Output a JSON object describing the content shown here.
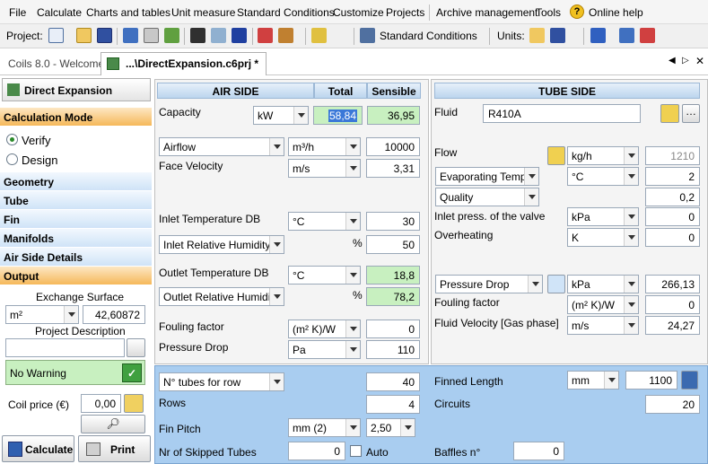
{
  "menu": [
    "File",
    "Calculate",
    "Charts and tables",
    "Unit measure",
    "Standard Conditions",
    "Customize",
    "Projects",
    "Archive management",
    "Tools",
    "Online help"
  ],
  "toolbar": {
    "project_label": "Project:",
    "conditions_label": "Standard Conditions",
    "units_label": "Units:"
  },
  "tabs": {
    "welcome": "Coils 8.0 - Welcome!",
    "active": "...\\DirectExpansion.c6prj *"
  },
  "left": {
    "title": "Direct Expansion",
    "calc_mode": "Calculation Mode",
    "verify": "Verify",
    "design": "Design",
    "sections": [
      "Geometry",
      "Tube",
      "Fin",
      "Manifolds",
      "Air Side Details",
      "Output"
    ],
    "exchange_surface_label": "Exchange Surface",
    "surface_unit": "m²",
    "surface_value": "42,60872",
    "project_desc_label": "Project Description",
    "project_desc_value": "",
    "warning": "No Warning",
    "coil_price_label": "Coil price (€)",
    "coil_price_value": "0,00",
    "calculate": "Calculate",
    "print": "Print"
  },
  "air": {
    "header": "AIR SIDE",
    "total": "Total",
    "sensible": "Sensible",
    "capacity_label": "Capacity",
    "capacity_unit": "kW",
    "capacity_total": "58,84",
    "capacity_sensible": "36,95",
    "airflow_select": "Airflow",
    "airflow_unit": "m³/h",
    "airflow_value": "10000",
    "face_velocity_label": "Face Velocity",
    "face_velocity_unit": "m/s",
    "face_velocity_value": "3,31",
    "inlet_temp_label": "Inlet Temperature DB",
    "inlet_temp_unit": "°C",
    "inlet_temp_value": "30",
    "inlet_rh_select": "Inlet Relative Humidity",
    "inlet_rh_unit": "%",
    "inlet_rh_value": "50",
    "outlet_temp_label": "Outlet Temperature DB",
    "outlet_temp_unit": "°C",
    "outlet_temp_value": "18,8",
    "outlet_rh_select": "Outlet Relative Humidity",
    "outlet_rh_unit": "%",
    "outlet_rh_value": "78,2",
    "fouling_label": "Fouling factor",
    "fouling_unit": "(m² K)/W",
    "fouling_value": "0",
    "pressure_label": "Pressure Drop",
    "pressure_unit": "Pa",
    "pressure_value": "110"
  },
  "tube": {
    "header": "TUBE SIDE",
    "fluid_label": "Fluid",
    "fluid_value": "R410A",
    "flow_label": "Flow",
    "flow_unit": "kg/h",
    "flow_value": "1210",
    "evap_select": "Evaporating Temp.",
    "evap_unit": "°C",
    "evap_value": "2",
    "quality_select": "Quality",
    "quality_value": "0,2",
    "inlet_press_label": "Inlet press. of the valve",
    "inlet_press_unit": "kPa",
    "inlet_press_value": "0",
    "overheating_label": "Overheating",
    "overheating_unit": "K",
    "overheating_value": "0",
    "pdrop_select": "Pressure Drop",
    "pdrop_unit": "kPa",
    "pdrop_value": "266,13",
    "fouling_label": "Fouling factor",
    "fouling_unit": "(m² K)/W",
    "fouling_value": "0",
    "velocity_label": "Fluid Velocity [Gas phase]",
    "velocity_unit": "m/s",
    "velocity_value": "24,27"
  },
  "geom": {
    "tubes_select": "N° tubes for row",
    "tubes_value": "40",
    "rows_label": "Rows",
    "rows_value": "4",
    "fin_pitch_label": "Fin Pitch",
    "fin_pitch_unit": "mm (2)",
    "fin_pitch_value": "2,50",
    "skipped_label": "Nr of Skipped Tubes",
    "skipped_value": "0",
    "auto_label": "Auto",
    "finned_label": "Finned Length",
    "finned_unit": "mm",
    "finned_value": "1100",
    "circuits_label": "Circuits",
    "circuits_value": "20",
    "baffles_label": "Baffles n°",
    "baffles_value": "0"
  },
  "colors": {
    "accent_orange": "#f5b85a",
    "header_blue": "#bcd5ee",
    "bottom_blue": "#a9cdf0",
    "green": "#c8f0c0"
  }
}
